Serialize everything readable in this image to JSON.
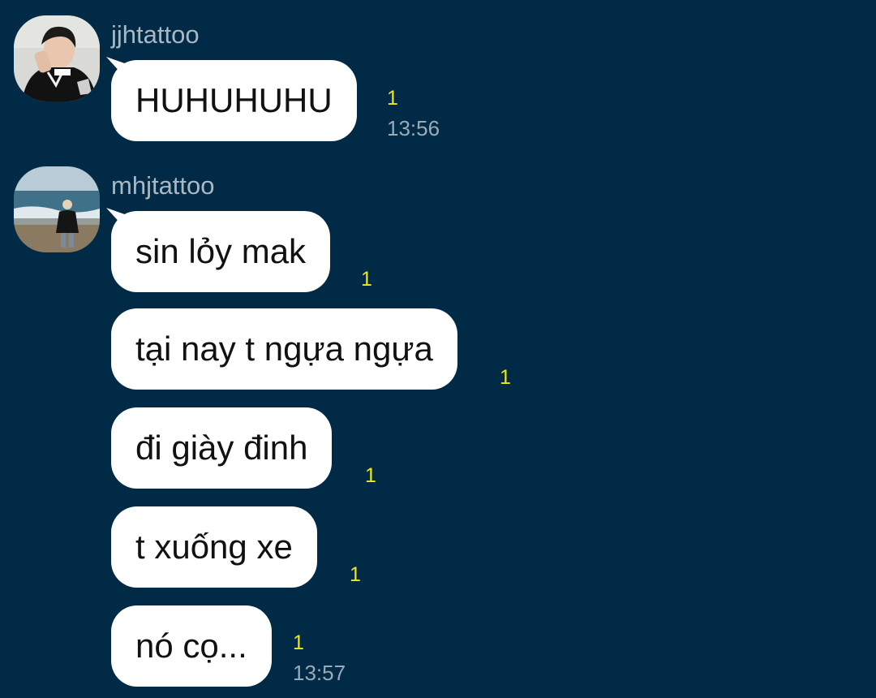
{
  "messages": {
    "group1": {
      "sender": "jjhtattoo",
      "avatar": "profile-photo-avatar",
      "bubbles": [
        {
          "text": "HUHUHUHU",
          "unread": "1",
          "time": "13:56"
        }
      ]
    },
    "group2": {
      "sender": "mhjtattoo",
      "avatar": "beach-photo-avatar",
      "bubbles": [
        {
          "text": "sin lỏy mak",
          "unread": "1"
        },
        {
          "text": "tại nay t ngựa ngựa",
          "unread": "1"
        },
        {
          "text": "đi giày đinh",
          "unread": "1"
        },
        {
          "text": "t xuống xe",
          "unread": "1"
        },
        {
          "text": "nó cọ...",
          "unread": "1",
          "time": "13:57"
        }
      ]
    }
  },
  "colors": {
    "background": "#002a45",
    "bubble": "#ffffff",
    "unread": "#f2e51a",
    "meta_text": "#a9b8c3"
  }
}
